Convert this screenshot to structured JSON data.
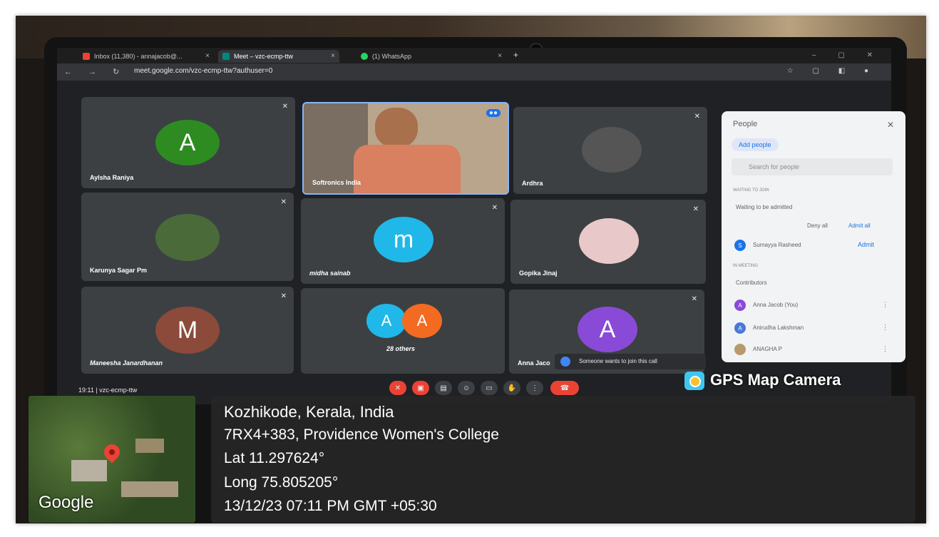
{
  "browser": {
    "tabs": [
      {
        "label": "Inbox (11,380) - annajacob@...",
        "close": "×"
      },
      {
        "label": "Meet – vzc-ecmp-ttw",
        "close": "×"
      },
      {
        "label": "(1) WhatsApp",
        "close": "×"
      }
    ],
    "new_tab": "+",
    "url": "meet.google.com/vzc-ecmp-ttw?authuser=0"
  },
  "meet": {
    "tiles": [
      {
        "name": "Aylsha Raniya",
        "avatar": "A",
        "color": "#2e8b22"
      },
      {
        "name": "Softronics India",
        "avatar": "",
        "color": "#c06a4a"
      },
      {
        "name": "Ardhra",
        "avatar": "",
        "color": "#555555"
      },
      {
        "name": "Karunya Sagar Pm",
        "avatar": "",
        "color": "#4a6a3a"
      },
      {
        "name": "midha sainab",
        "avatar": "m",
        "color": "#1fb8e8"
      },
      {
        "name": "Gopika Jinaj",
        "avatar": "",
        "color": "#e8c8c8"
      },
      {
        "name": "Maneesha Janardhanan",
        "avatar": "M",
        "color": "#8b4a3a"
      },
      {
        "name": "28 others",
        "avatar": "A",
        "color": "#1fb8e8"
      },
      {
        "name": "Anna Jaco",
        "avatar": "A",
        "color": "#8a4ad8"
      }
    ],
    "join_notice": "Someone wants to join this call",
    "footer": "19:11  |  vzc-ecmp-ttw"
  },
  "people_panel": {
    "title": "People",
    "add_people": "Add people",
    "search_placeholder": "Search for people",
    "waiting_header": "WAITING TO JOIN",
    "waiting_label": "Waiting to be admitted",
    "deny_all": "Deny all",
    "admit_all": "Admit all",
    "waiting_person": {
      "name": "Sumayya Rasheed",
      "action": "Admit",
      "initial": "S"
    },
    "meeting_header": "IN MEETING",
    "contributors_label": "Contributors",
    "contributors": [
      {
        "name": "Anna Jacob (You)",
        "initial": "A",
        "color": "#8a4ad8"
      },
      {
        "name": "Anirudha Lakshman",
        "initial": "A",
        "color": "#4a7ad8"
      },
      {
        "name": "ANAGHA P",
        "initial": "",
        "color": "#b89a6a"
      }
    ]
  },
  "gps": {
    "badge": "GPS Map Camera",
    "map_logo": "Google",
    "line1": "Kozhikode, Kerala, India",
    "line2": "7RX4+383, Providence Women's College",
    "line3": "Lat 11.297624°",
    "line4": "Long 75.805205°",
    "line5": "13/12/23 07:11 PM GMT +05:30"
  },
  "colors": {
    "meet_bg": "#202124",
    "tile_bg": "#3c4043",
    "danger": "#ea4335",
    "accent": "#1a73e8"
  }
}
